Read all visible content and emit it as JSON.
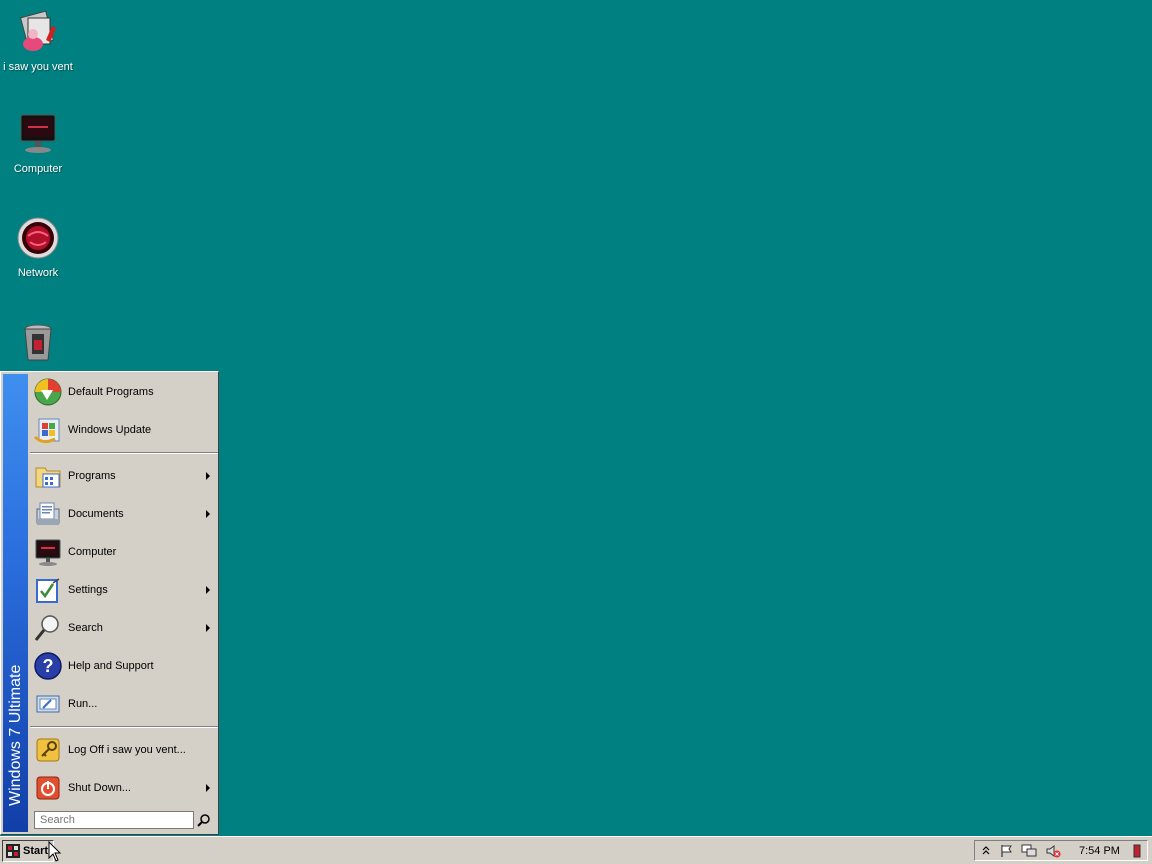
{
  "desktop": {
    "icons": [
      {
        "label": "i saw you vent"
      },
      {
        "label": "Computer"
      },
      {
        "label": "Network"
      },
      {
        "label": ""
      }
    ]
  },
  "start_menu": {
    "banner": "Windows 7 Ultimate",
    "items": [
      {
        "label": "Default Programs",
        "icon": "default-programs-icon"
      },
      {
        "label": "Windows Update",
        "icon": "windows-update-icon"
      },
      {
        "label": "Programs",
        "icon": "programs-icon",
        "submenu": true
      },
      {
        "label": "Documents",
        "icon": "documents-icon",
        "submenu": true
      },
      {
        "label": "Computer",
        "icon": "computer-icon"
      },
      {
        "label": "Settings",
        "icon": "settings-icon",
        "submenu": true
      },
      {
        "label": "Search",
        "icon": "search-icon",
        "submenu": true
      },
      {
        "label": "Help and Support",
        "icon": "help-icon"
      },
      {
        "label": "Run...",
        "icon": "run-icon"
      },
      {
        "label": "Log Off i saw you vent...",
        "icon": "logoff-key-icon"
      },
      {
        "label": "Shut Down...",
        "icon": "shutdown-icon",
        "submenu": true
      }
    ],
    "search": {
      "placeholder": "Search",
      "value": ""
    }
  },
  "taskbar": {
    "start_label": "Start",
    "clock": "7:54 PM"
  },
  "colors": {
    "desktop": "#008080",
    "chrome": "#d4d0c8",
    "banner_top": "#3f8fef",
    "banner_bottom": "#123fa8"
  }
}
